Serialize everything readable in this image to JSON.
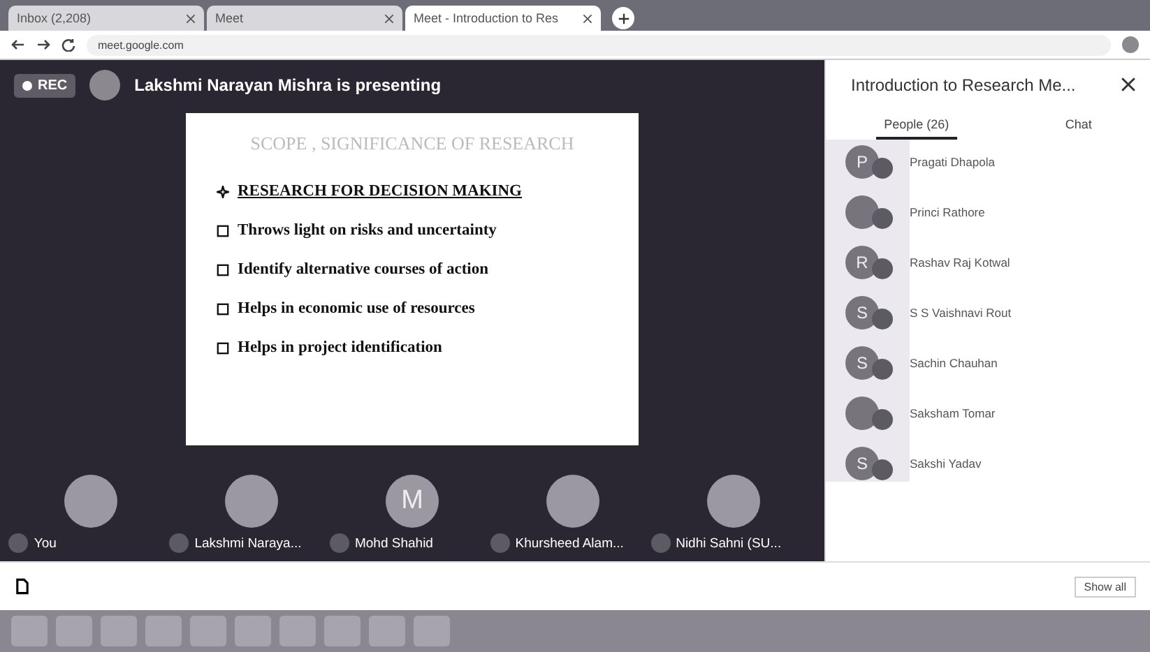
{
  "browser": {
    "tabs": [
      {
        "label": "Inbox (2,208)",
        "selected": false
      },
      {
        "label": "Meet",
        "selected": false
      },
      {
        "label": "Meet - Introduction to Res",
        "selected": true
      }
    ],
    "address": "meet.google.com"
  },
  "meeting": {
    "recording": true,
    "rec_label": "REC",
    "presenter_banner": "Lakshmi Narayan Mishra is presenting",
    "slide": {
      "title": "SCOPE , SIGNIFICANCE OF RESEARCH",
      "items": [
        {
          "kind": "heading",
          "text": "RESEARCH FOR DECISION MAKING"
        },
        {
          "kind": "bullet",
          "text": "Throws light on risks and uncertainty"
        },
        {
          "kind": "bullet",
          "text": "Identify alternative courses of action"
        },
        {
          "kind": "bullet",
          "text": "Helps in economic use of resources"
        },
        {
          "kind": "bullet",
          "text": "Helps in project identification"
        }
      ]
    },
    "tiles": [
      {
        "name": "You"
      },
      {
        "name": "Lakshmi Naraya..."
      },
      {
        "name": "Mohd Shahid",
        "initial": "M"
      },
      {
        "name": "Khursheed Alam..."
      },
      {
        "name": "Nidhi Sahni (SU..."
      }
    ]
  },
  "panel": {
    "title": "Introduction to Research Me...",
    "tabs": [
      {
        "label": "People (26)",
        "selected": true
      },
      {
        "label": "Chat",
        "selected": false
      }
    ],
    "people": [
      {
        "name": "Pragati Dhapola",
        "initial": "P"
      },
      {
        "name": "Princi Rathore"
      },
      {
        "name": "Rashav Raj Kotwal",
        "initial": "R"
      },
      {
        "name": "S S Vaishnavi Rout",
        "initial": "S"
      },
      {
        "name": "Sachin Chauhan",
        "initial": "S"
      },
      {
        "name": "Saksham Tomar"
      },
      {
        "name": "Sakshi Yadav",
        "initial": "S"
      }
    ]
  },
  "downloads": {
    "show_all": "Show all"
  }
}
